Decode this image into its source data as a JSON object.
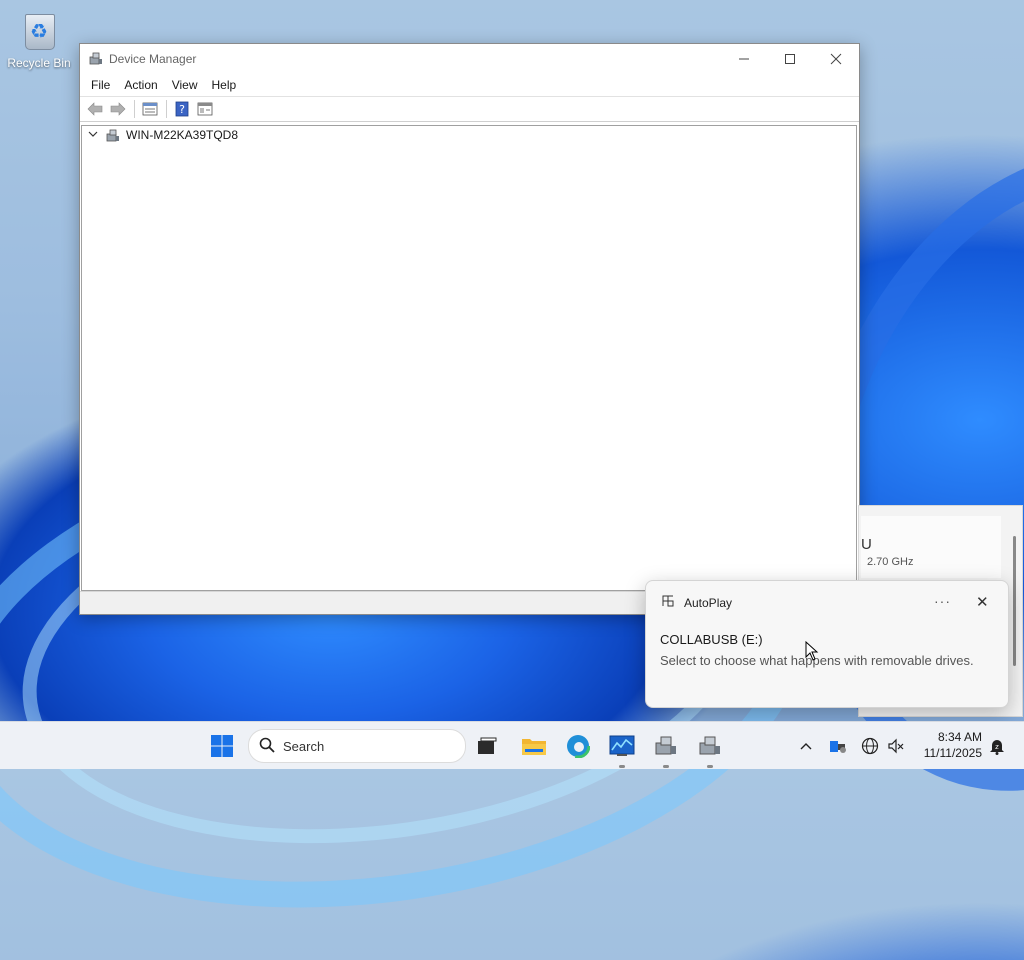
{
  "desktop": {
    "recycle_bin_label": "Recycle Bin"
  },
  "window": {
    "title": "Device Manager",
    "menu": [
      "File",
      "Action",
      "View",
      "Help"
    ],
    "tree_root": "WIN-M22KA39TQD8"
  },
  "side_panel": {
    "letter": "U",
    "speed": "2.70 GHz"
  },
  "toast": {
    "app_name": "AutoPlay",
    "more_label": "···",
    "close_label": "✕",
    "title": "COLLABUSB (E:)",
    "body": "Select to choose what happens with removable drives."
  },
  "taskbar": {
    "search_label": "Search",
    "time": "8:34 AM",
    "date": "11/11/2025"
  },
  "colors": {
    "windows_blue": "#1a73e8",
    "toast_bg": "#f7f7f7",
    "taskbar_bg": "#eef1f6"
  }
}
